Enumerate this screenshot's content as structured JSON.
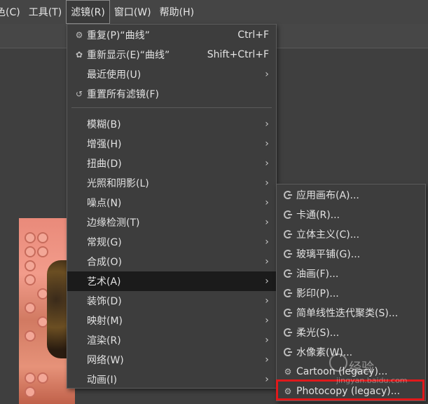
{
  "menubar": {
    "items": [
      {
        "label": "色(C)"
      },
      {
        "label": "工具(T)"
      },
      {
        "label": "滤镜(R)",
        "active": true
      },
      {
        "label": "窗口(W)"
      },
      {
        "label": "帮助(H)"
      }
    ]
  },
  "filters_menu": {
    "items": [
      {
        "label": "重复(P)“曲线”",
        "shortcut": "Ctrl+F",
        "icon": "repeat-gear-icon"
      },
      {
        "label": "重新显示(E)“曲线”",
        "shortcut": "Shift+Ctrl+F",
        "icon": "reshow-icon"
      },
      {
        "label": "最近使用(U)",
        "submenu": true
      },
      {
        "label": "重置所有滤镜(F)",
        "icon": "reset-icon"
      },
      {
        "label": "模糊(B)",
        "submenu": true
      },
      {
        "label": "增强(H)",
        "submenu": true
      },
      {
        "label": "扭曲(D)",
        "submenu": true
      },
      {
        "label": "光照和阴影(L)",
        "submenu": true
      },
      {
        "label": "噪点(N)",
        "submenu": true
      },
      {
        "label": "边缘检测(T)",
        "submenu": true
      },
      {
        "label": "常规(G)",
        "submenu": true
      },
      {
        "label": "合成(O)",
        "submenu": true
      },
      {
        "label": "艺术(A)",
        "submenu": true,
        "highlighted": true
      },
      {
        "label": "装饰(D)",
        "submenu": true
      },
      {
        "label": "映射(M)",
        "submenu": true
      },
      {
        "label": "渲染(R)",
        "submenu": true
      },
      {
        "label": "网络(W)",
        "submenu": true
      },
      {
        "label": "动画(I)",
        "submenu": true
      }
    ]
  },
  "artistic_submenu": {
    "items": [
      {
        "label": "应用画布(A)...",
        "icon": "gegl-icon"
      },
      {
        "label": "卡通(R)...",
        "icon": "gegl-icon"
      },
      {
        "label": "立体主义(C)...",
        "icon": "gegl-icon"
      },
      {
        "label": "玻璃平铺(G)...",
        "icon": "gegl-icon"
      },
      {
        "label": "油画(F)...",
        "icon": "gegl-icon"
      },
      {
        "label": "影印(P)...",
        "icon": "gegl-icon"
      },
      {
        "label": "简单线性迭代聚类(S)...",
        "icon": "gegl-icon"
      },
      {
        "label": "柔光(S)...",
        "icon": "gegl-icon"
      },
      {
        "label": "水像素(W)...",
        "icon": "gegl-icon"
      },
      {
        "label": "Cartoon (legacy)...",
        "icon": "gear-icon"
      },
      {
        "label": "Photocopy (legacy)...",
        "icon": "gear-icon",
        "highlighted_box": true
      }
    ]
  },
  "watermark": {
    "text": "经验",
    "url": "jingyan.baidu.com"
  },
  "colors": {
    "highlight": "#1b1b1b",
    "menu_bg": "#3d3d3d",
    "red_box": "#e0191b"
  }
}
